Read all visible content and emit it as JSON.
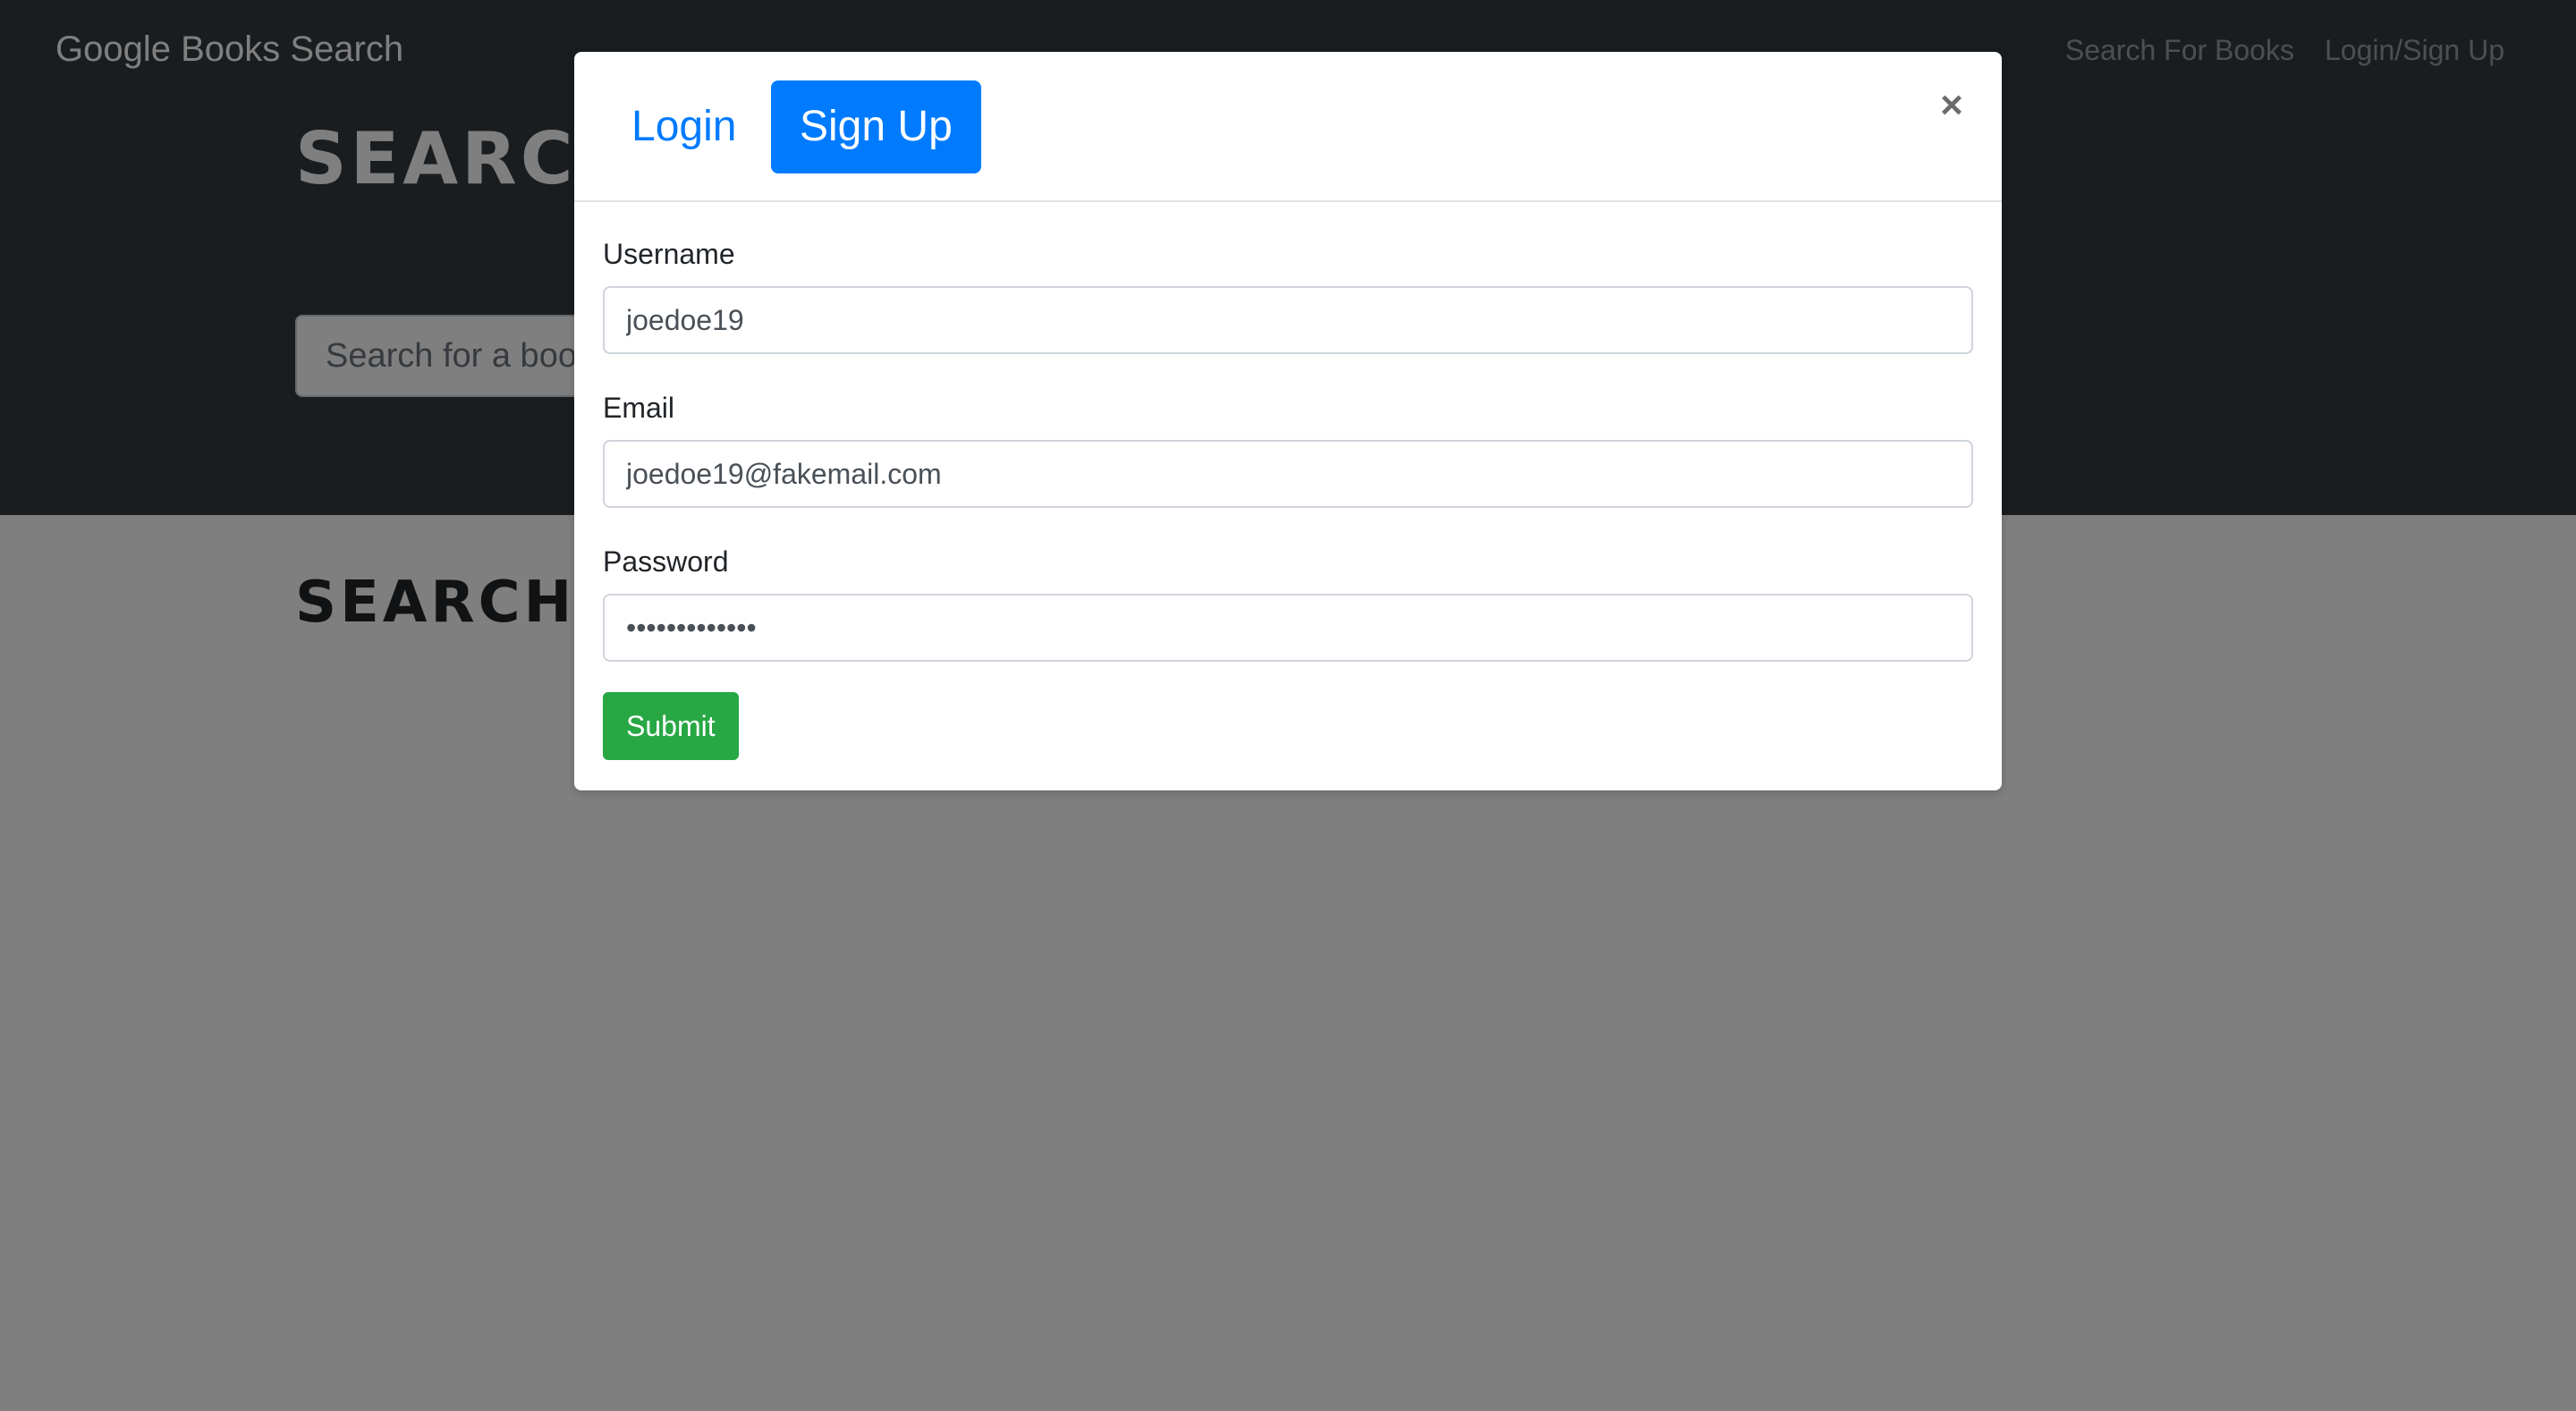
{
  "navbar": {
    "brand": "Google Books Search",
    "links": [
      "Search For Books",
      "Login/Sign Up"
    ]
  },
  "hero": {
    "title": "SEARCH FOR BOOKS!",
    "search_placeholder": "Search for a book"
  },
  "results": {
    "title": "SEARCH FOR A BOOK TO BEGIN"
  },
  "modal": {
    "tabs": [
      {
        "label": "Login",
        "active": false
      },
      {
        "label": "Sign Up",
        "active": true
      }
    ],
    "close_glyph": "×",
    "fields": {
      "username": {
        "label": "Username",
        "value": "joedoe19"
      },
      "email": {
        "label": "Email",
        "value": "joedoe19@fakemail.com"
      },
      "password": {
        "label": "Password",
        "value": "•••••••••••••"
      }
    },
    "submit_label": "Submit"
  },
  "colors": {
    "navbar_bg": "#343a40",
    "primary": "#007bff",
    "success": "#28a745",
    "backdrop": "rgba(0,0,0,0.5)"
  }
}
